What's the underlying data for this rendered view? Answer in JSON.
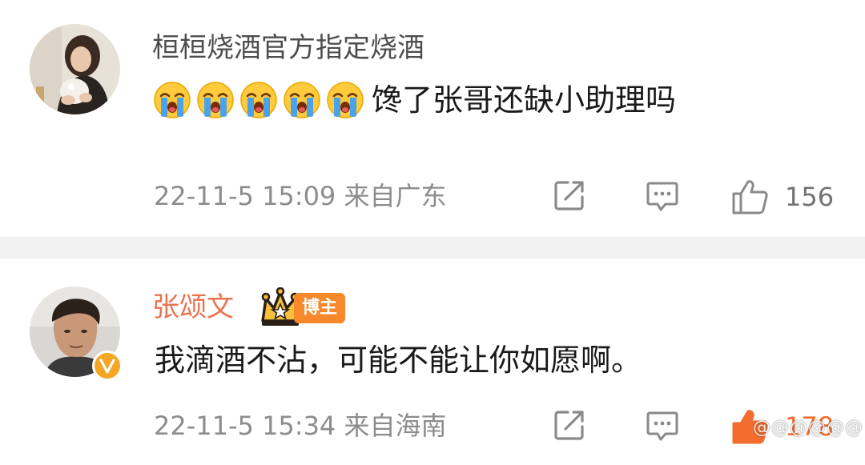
{
  "comments": [
    {
      "username": "桓桓烧酒官方指定烧酒",
      "emoji_icon": "loudly-crying-face",
      "emoji_count": 5,
      "text": "馋了张哥还缺小助理吗",
      "time_location": "22-11-5 15:09 来自广东",
      "like_count": "156",
      "liked": false,
      "verified": false
    },
    {
      "username": "张颂文",
      "tag": "博主",
      "text": "我滴酒不沾，可能不能让你如愿啊。",
      "time_location": "22-11-5 15:34 来自海南",
      "like_count": "178",
      "liked": true,
      "verified": true
    }
  ],
  "colors": {
    "username_default": "#4d4d4d",
    "username_vip": "#eb7350",
    "muted_text": "#8c8c8c",
    "like_active": "#f26d2e",
    "badge_orange": "#f7892c",
    "verified_badge": "#f5a623",
    "divider": "#f2f2f2"
  },
  "icons": {
    "share": "share-icon",
    "reply": "comment-icon",
    "like": "thumbs-up-icon",
    "crown": "crown-icon",
    "verified": "verified-v-badge"
  }
}
